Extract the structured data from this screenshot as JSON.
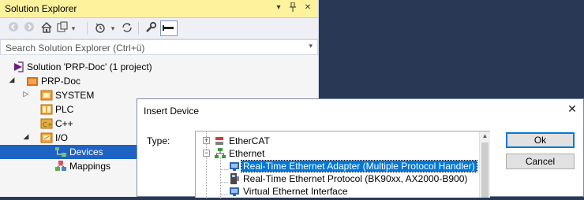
{
  "solution_explorer": {
    "title": "Solution Explorer",
    "title_buttons": [
      "dropdown-icon",
      "pin-icon",
      "close-icon"
    ],
    "search_placeholder": "Search Solution Explorer (Ctrl+ü)",
    "tree": [
      {
        "label": "Solution 'PRP-Doc' (1 project)",
        "icon": "solution-icon",
        "expander": "",
        "level": 0,
        "selected": false
      },
      {
        "label": "PRP-Doc",
        "icon": "project-icon",
        "expander": "expanded",
        "level": 0,
        "selected": false
      },
      {
        "label": "SYSTEM",
        "icon": "system-icon",
        "expander": "collapsed",
        "level": 1,
        "selected": false
      },
      {
        "label": "PLC",
        "icon": "plc-icon",
        "expander": "",
        "level": 1,
        "selected": false
      },
      {
        "label": "C++",
        "icon": "cpp-icon",
        "expander": "",
        "level": 1,
        "selected": false
      },
      {
        "label": "I/O",
        "icon": "io-icon",
        "expander": "expanded",
        "level": 1,
        "selected": false
      },
      {
        "label": "Devices",
        "icon": "devices-icon",
        "expander": "",
        "level": 2,
        "selected": true
      },
      {
        "label": "Mappings",
        "icon": "mappings-icon",
        "expander": "",
        "level": 2,
        "selected": false
      }
    ]
  },
  "dialog": {
    "title": "Insert Device",
    "type_label": "Type:",
    "ok_label": "Ok",
    "cancel_label": "Cancel",
    "tree": [
      {
        "label": "EtherCAT",
        "icon": "ethercat-icon",
        "expander": "+",
        "level": 0,
        "selected": false
      },
      {
        "label": "Ethernet",
        "icon": "ethernet-icon",
        "expander": "-",
        "level": 0,
        "selected": false
      },
      {
        "label": "Real-Time Ethernet Adapter (Multiple Protocol Handler)",
        "icon": "adapter-icon",
        "expander": "",
        "level": 1,
        "selected": true
      },
      {
        "label": "Real-Time Ethernet Protocol (BK90xx, AX2000-B900)",
        "icon": "protocol-icon",
        "expander": "",
        "level": 1,
        "selected": false
      },
      {
        "label": "Virtual Ethernet Interface",
        "icon": "adapter-icon",
        "expander": "",
        "level": 1,
        "selected": false
      }
    ]
  }
}
